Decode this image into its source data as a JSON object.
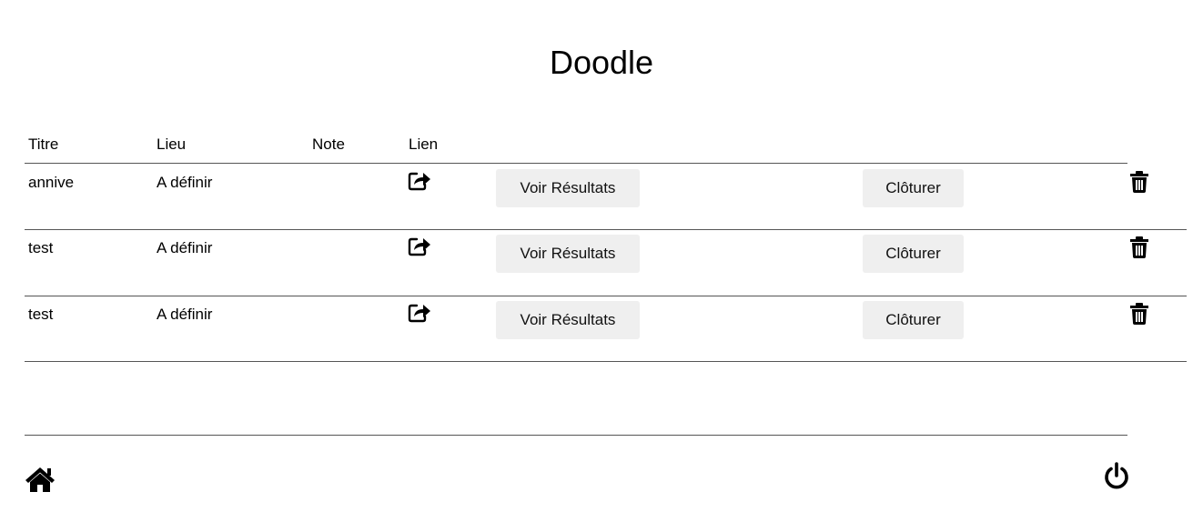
{
  "page_title": "Doodle",
  "table": {
    "headers": {
      "titre": "Titre",
      "lieu": "Lieu",
      "note": "Note",
      "lien": "Lien"
    },
    "rows": [
      {
        "titre": "annive",
        "lieu": "A définir",
        "note": "",
        "link_icon": "share-icon",
        "results_label": "Voir Résultats",
        "close_label": "Clôturer",
        "delete_icon": "trash-icon"
      },
      {
        "titre": "test",
        "lieu": "A définir",
        "note": "",
        "link_icon": "share-icon",
        "results_label": "Voir Résultats",
        "close_label": "Clôturer",
        "delete_icon": "trash-icon"
      },
      {
        "titre": "test",
        "lieu": "A définir",
        "note": "",
        "link_icon": "share-icon",
        "results_label": "Voir Résultats",
        "close_label": "Clôturer",
        "delete_icon": "trash-icon"
      }
    ]
  },
  "footer": {
    "home_icon": "home-icon",
    "logout_icon": "power-icon"
  },
  "colors": {
    "button_bg": "#efefef",
    "divider": "#555555",
    "text": "#000000"
  }
}
